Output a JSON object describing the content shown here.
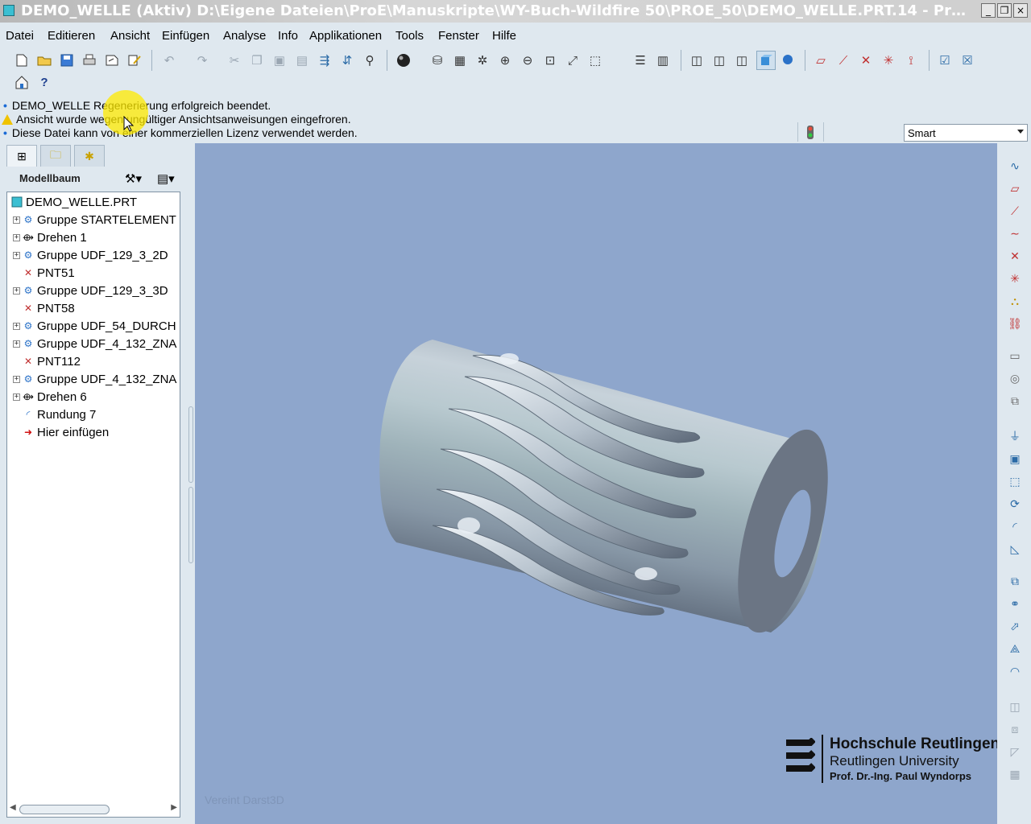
{
  "window": {
    "title": "DEMO_WELLE (Aktiv) D:\\Eigene Dateien\\ProE\\Manuskripte\\WY-Buch-Wildfire 50\\PROE_50\\DEMO_WELLE.PRT.14 - Pro...",
    "minimize": "_",
    "restore": "❐",
    "close": "×"
  },
  "menu": [
    "Datei",
    "Editieren",
    "Ansicht",
    "Einfügen",
    "Analyse",
    "Info",
    "Applikationen",
    "Tools",
    "Fenster",
    "Hilfe"
  ],
  "messages": [
    "DEMO_WELLE Regenerierung erfolgreich beendet.",
    "Ansicht wurde wegen ungültiger Ansichtsanweisungen eingefroren.",
    "Diese Datei kann von einer kommerziellen Lizenz verwendet werden."
  ],
  "filter": {
    "value": "Smart"
  },
  "tree": {
    "title": "Modellbaum",
    "root": "DEMO_WELLE.PRT",
    "items": [
      {
        "label": "Gruppe STARTELEMENT",
        "icon": "group-icon",
        "expandable": true
      },
      {
        "label": "Drehen 1",
        "icon": "revolve-icon",
        "expandable": true
      },
      {
        "label": "Gruppe UDF_129_3_2D",
        "icon": "group-icon",
        "expandable": true
      },
      {
        "label": "PNT51",
        "icon": "datum-point-icon",
        "expandable": false
      },
      {
        "label": "Gruppe UDF_129_3_3D",
        "icon": "group-icon",
        "expandable": true
      },
      {
        "label": "PNT58",
        "icon": "datum-point-icon",
        "expandable": false
      },
      {
        "label": "Gruppe UDF_54_DURCH",
        "icon": "group-icon",
        "expandable": true
      },
      {
        "label": "Gruppe UDF_4_132_ZNA",
        "icon": "group-icon",
        "expandable": true
      },
      {
        "label": "PNT112",
        "icon": "datum-point-icon",
        "expandable": false
      },
      {
        "label": "Gruppe UDF_4_132_ZNA",
        "icon": "group-icon",
        "expandable": true
      },
      {
        "label": "Drehen 6",
        "icon": "revolve-icon",
        "expandable": true
      },
      {
        "label": "Rundung 7",
        "icon": "round-icon",
        "expandable": false
      },
      {
        "label": "Hier einfügen",
        "icon": "insert-here-icon",
        "expandable": false
      }
    ]
  },
  "viewport": {
    "watermark": "Vereint Darst3D",
    "logo": {
      "line1": "Hochschule Reutlingen",
      "line2": "Reutlingen University",
      "line3": "Prof. Dr.-Ing. Paul Wyndorps"
    }
  },
  "colors": {
    "viewport_bg": "#8ea6cc",
    "panel_bg": "#dfe8ef",
    "accent": "#1a6ad6",
    "warning": "#f0c300"
  }
}
